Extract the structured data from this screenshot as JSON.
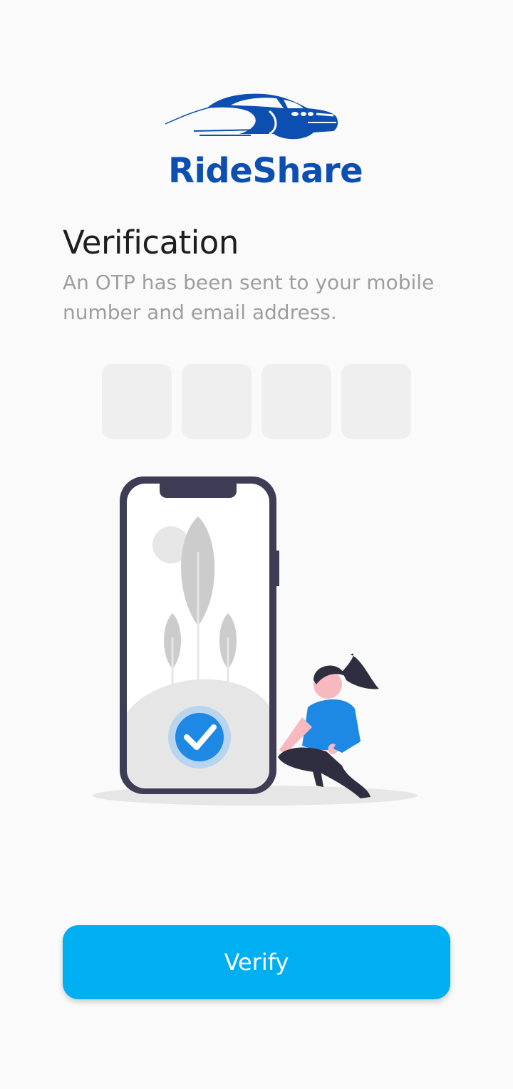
{
  "brand": {
    "name": "RideShare",
    "color": "#0d4fb0",
    "icon": "car-logo-icon"
  },
  "heading": {
    "title": "Verification",
    "subtitle": "An OTP has been sent to your mobile number and email address."
  },
  "otp": {
    "digits": [
      {
        "value": "",
        "placeholder": ""
      },
      {
        "value": "",
        "placeholder": ""
      },
      {
        "value": "",
        "placeholder": ""
      },
      {
        "value": "",
        "placeholder": ""
      }
    ]
  },
  "illustration": {
    "icon": "phone-verified-illustration",
    "check_icon": "check-badge-icon"
  },
  "actions": {
    "verify_label": "Verify",
    "accent": "#00aef2"
  }
}
